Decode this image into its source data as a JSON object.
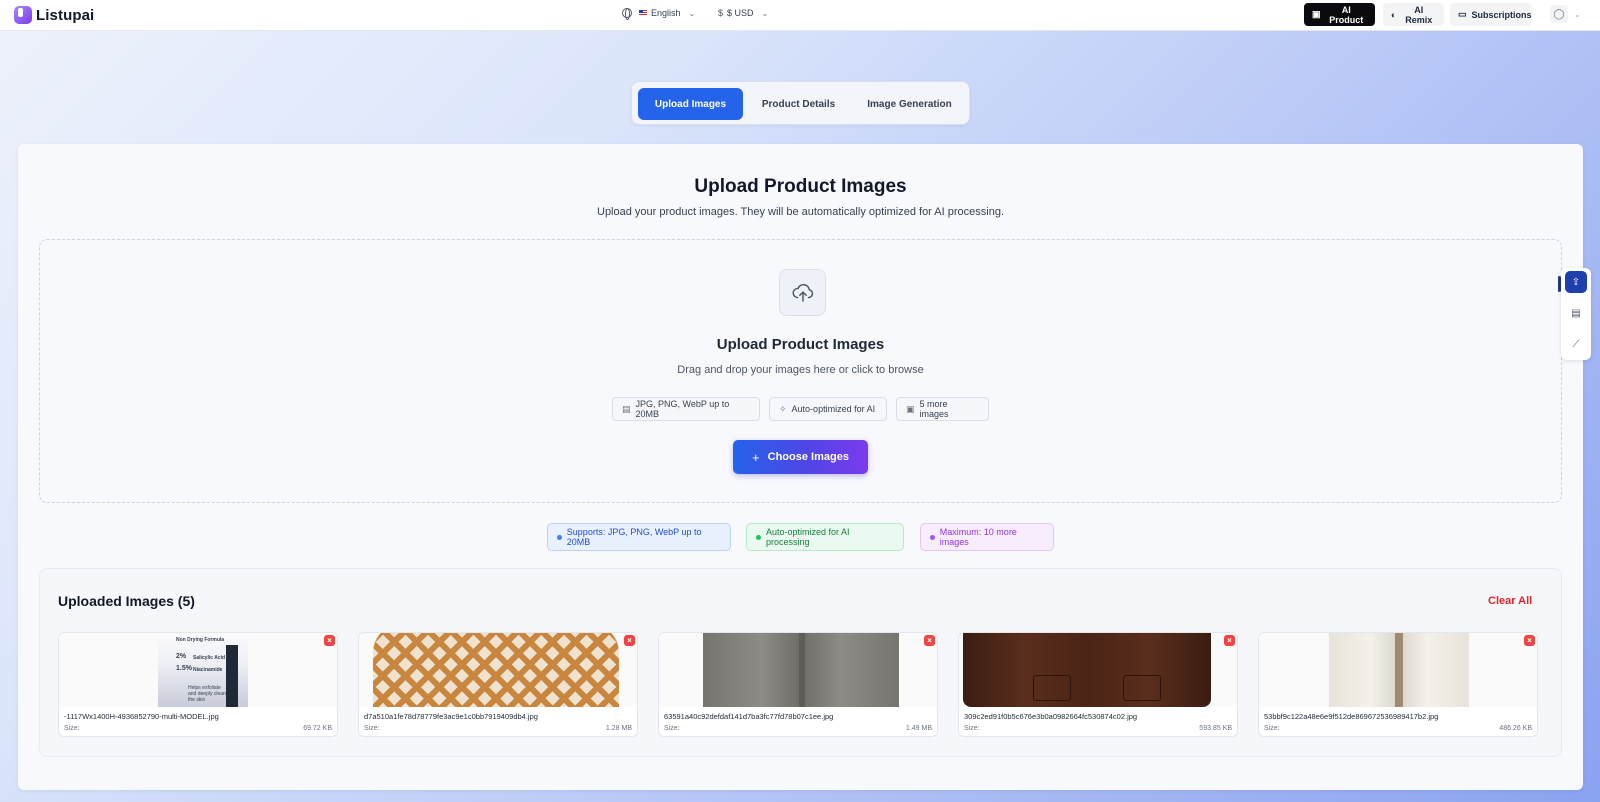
{
  "app": {
    "name": "Listupai"
  },
  "header": {
    "language": "English",
    "currency": "$ USD",
    "buttons": {
      "ai_product": "AI Product",
      "ai_remix": "AI Remix",
      "subscriptions": "Subscriptions"
    }
  },
  "tabs": [
    {
      "label": "Upload Images",
      "active": true
    },
    {
      "label": "Product Details",
      "active": false
    },
    {
      "label": "Image Generation",
      "active": false
    }
  ],
  "main": {
    "title": "Upload Product Images",
    "subtitle": "Upload your product images. They will be automatically optimized for AI processing."
  },
  "dropzone": {
    "title": "Upload Product Images",
    "subtitle": "Drag and drop your images here or click to browse",
    "pills": [
      {
        "label": "JPG, PNG, WebP up to 20MB",
        "icon": "file-icon"
      },
      {
        "label": "Auto-optimized for AI",
        "icon": "sparkle-icon"
      },
      {
        "label": "5 more images",
        "icon": "archive-icon"
      }
    ],
    "choose_button": "Choose Images"
  },
  "info": {
    "supports": "Supports: JPG, PNG, WebP up to 20MB",
    "optimized": "Auto-optimized for AI processing",
    "maximum": "Maximum: 10 more images"
  },
  "uploaded": {
    "title": "Uploaded Images (5)",
    "clear_all": "Clear All",
    "size_label": "Size:",
    "files": [
      {
        "name": "-1117Wx1400H-4936852790-multi-MODEL.jpg",
        "size": "69.72 KB"
      },
      {
        "name": "d7a510a1fe78d78779fe3ac9e1c0bb7919409db4.jpg",
        "size": "1.28 MB"
      },
      {
        "name": "63591a40c92defdaf141d7ba3fc77fd78b07c1ee.jpg",
        "size": "1.49 MB"
      },
      {
        "name": "309c2ed91f0b5c676e3b0a0982664fc530874c02.jpg",
        "size": "593.85 KB"
      },
      {
        "name": "53bbf9c122a48e6e9f512de869672536989417b2.jpg",
        "size": "486.26 KB"
      }
    ]
  },
  "product_label_text": {
    "line1": "Non Drying Formula",
    "line2": "2%",
    "line2b": "Salicylic Acid",
    "line3": "1.5%",
    "line3b": "Niacinamide",
    "line4": "Helps exfoliate and deeply clean the skin"
  },
  "colors": {
    "primary": "#2563eb",
    "danger": "#dc2626",
    "gradient_end": "#7c3aed"
  }
}
